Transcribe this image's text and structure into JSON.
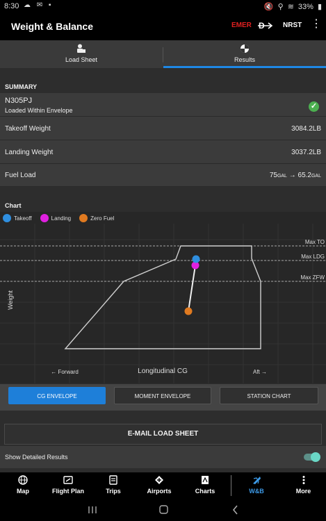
{
  "status": {
    "time": "8:30",
    "battery": "33%"
  },
  "appbar": {
    "title": "Weight & Balance",
    "emer": "EMER",
    "nrst": "NRST"
  },
  "tabs": [
    {
      "label": "Load Sheet",
      "icon": "load-sheet-icon"
    },
    {
      "label": "Results",
      "icon": "results-icon"
    }
  ],
  "summary": {
    "header": "SUMMARY",
    "tail": "N305PJ",
    "status": "Loaded Within Envelope",
    "takeoff_label": "Takeoff Weight",
    "takeoff_value": "3084.2LB",
    "landing_label": "Landing Weight",
    "landing_value": "3037.2LB",
    "fuel_label": "Fuel Load",
    "fuel_from": "75",
    "fuel_from_unit": "GAL",
    "fuel_arrow": "→",
    "fuel_to": "65.2",
    "fuel_to_unit": "GAL"
  },
  "chart": {
    "header": "Chart",
    "legend": [
      {
        "name": "Takeoff",
        "color": "#2f8fe0"
      },
      {
        "name": "Landing",
        "color": "#e020e0"
      },
      {
        "name": "Zero Fuel",
        "color": "#e07a20"
      }
    ],
    "limit_labels": [
      "Max TO",
      "Max LDG",
      "Max ZFW"
    ],
    "ylabel": "Weight",
    "xlabel": "Longitudinal CG",
    "forward": "← Forward",
    "aft": "Aft →"
  },
  "chart_data": {
    "type": "scatter",
    "title": "",
    "xlabel": "Longitudinal CG",
    "ylabel": "Weight",
    "series": [
      {
        "name": "Takeoff",
        "weight": 3084.2
      },
      {
        "name": "Landing",
        "weight": 3037.2
      },
      {
        "name": "Zero Fuel"
      }
    ],
    "limits": [
      "Max TO",
      "Max LDG",
      "Max ZFW"
    ]
  },
  "buttons": {
    "cg_envelope": "CG ENVELOPE",
    "moment_envelope": "MOMENT ENVELOPE",
    "station_chart": "STATION CHART",
    "email": "E-MAIL LOAD SHEET"
  },
  "toggle": {
    "label": "Show Detailed Results",
    "on": true
  },
  "nav": [
    {
      "label": "Map",
      "icon": "globe-icon"
    },
    {
      "label": "Flight Plan",
      "icon": "flight-plan-icon"
    },
    {
      "label": "Trips",
      "icon": "trips-icon"
    },
    {
      "label": "Airports",
      "icon": "airports-icon"
    },
    {
      "label": "Charts",
      "icon": "charts-icon"
    },
    {
      "label": "W&B",
      "icon": "wb-icon"
    },
    {
      "label": "More",
      "icon": "more-icon"
    }
  ],
  "colors": {
    "accent": "#1e88e5",
    "takeoff": "#2f8fe0",
    "landing": "#e020e0",
    "zero_fuel": "#e07a20",
    "emer": "#e02020"
  }
}
